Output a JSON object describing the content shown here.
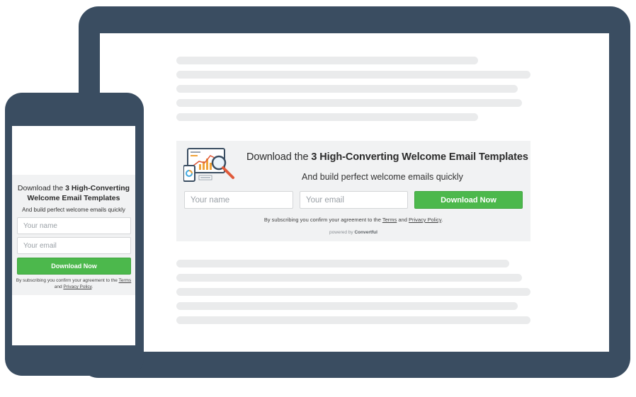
{
  "desktop_widget": {
    "title_prefix": "Download the ",
    "title_bold": "3 High-Converting Welcome Email Templates",
    "subtitle": "And build perfect welcome emails quickly",
    "name_placeholder": "Your name",
    "email_placeholder": "Your email",
    "button_label": "Download Now",
    "consent_prefix": "By subscribing you confirm your agreement to the ",
    "terms_label": "Terms",
    "consent_and": " and ",
    "privacy_label": "Privacy Policy",
    "consent_suffix": ".",
    "powered_prefix": "powered by ",
    "powered_brand": "Convertful"
  },
  "mobile_widget": {
    "title_prefix": "Download the ",
    "title_bold": "3 High-Converting Welcome Email Templates",
    "subtitle": "And build perfect welcome emails quickly",
    "name_placeholder": "Your name",
    "email_placeholder": "Your email",
    "button_label": "Download Now",
    "consent_prefix": "By subscribing you confirm your agreement to the ",
    "terms_label": "Terms",
    "consent_and": " and ",
    "privacy_label": "Privacy Policy",
    "consent_suffix": "."
  },
  "colors": {
    "device_frame": "#3a4d61",
    "widget_bg": "#f1f2f3",
    "button_green": "#4cb84c",
    "skeleton": "#eaebec"
  },
  "icons": {
    "illustration": "analytics-report-magnifier-icon"
  }
}
